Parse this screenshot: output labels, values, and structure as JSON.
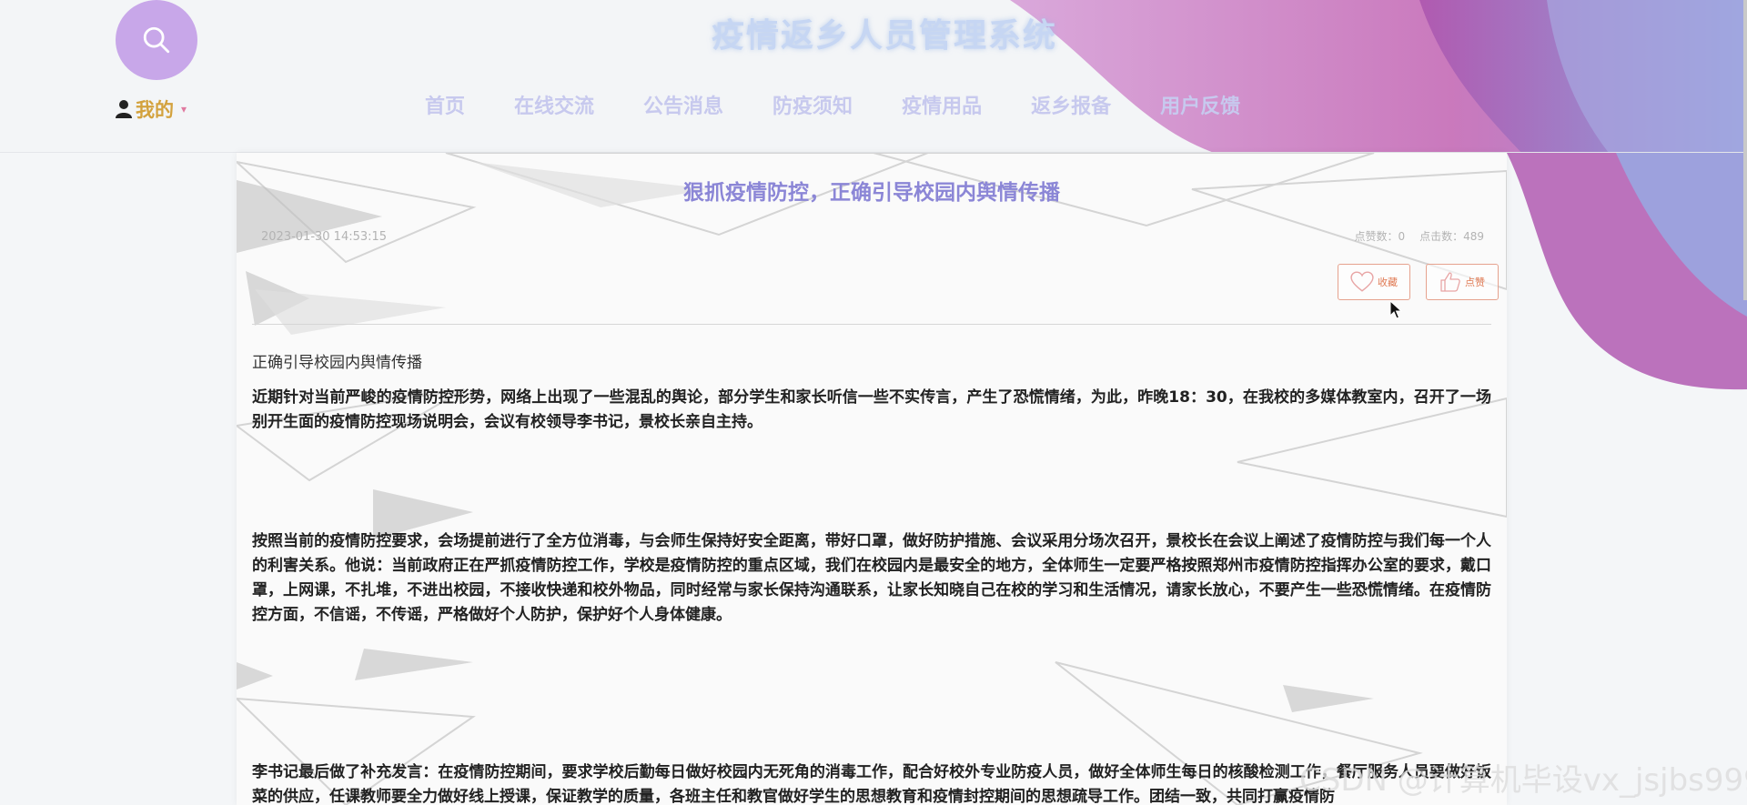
{
  "site": {
    "title": "疫情返乡人员管理系统"
  },
  "user_menu": {
    "label": "我的",
    "caret": "▾"
  },
  "nav": [
    {
      "label": "首页"
    },
    {
      "label": "在线交流"
    },
    {
      "label": "公告消息"
    },
    {
      "label": "防疫须知"
    },
    {
      "label": "疫情用品"
    },
    {
      "label": "返乡报备"
    },
    {
      "label": "用户反馈"
    }
  ],
  "article": {
    "title": "狠抓疫情防控，正确引导校园内舆情传播",
    "date": "2023-01-30 14:53:15",
    "likes_label": "点赞数：0",
    "clicks_label": "点击数：489",
    "collect_label": "收藏",
    "like_label": "点赞",
    "subhead": "正确引导校园内舆情传播",
    "paragraphs": [
      "近期针对当前严峻的疫情防控形势，网络上出现了一些混乱的舆论，部分学生和家长听信一些不实传言，产生了恐慌情绪，为此，昨晚18：30，在我校的多媒体教室内，召开了一场别开生面的疫情防控现场说明会，会议有校领导李书记，景校长亲自主持。",
      "按照当前的疫情防控要求，会场提前进行了全方位消毒，与会师生保持好安全距离，带好口罩，做好防护措施、会议采用分场次召开，景校长在会议上阐述了疫情防控与我们每一个人的利害关系。他说：当前政府正在严抓疫情防控工作，学校是疫情防控的重点区域，我们在校园内是最安全的地方，全体师生一定要严格按照郑州市疫情防控指挥办公室的要求，戴口罩，上网课，不扎堆，不进出校园，不接收快递和校外物品，同时经常与家长保持沟通联系，让家长知晓自己在校的学习和生活情况，请家长放心，不要产生一些恐慌情绪。在疫情防控方面，不信谣，不传谣，严格做好个人防护，保护好个人身体健康。",
      "李书记最后做了补充发言：在疫情防控期间，要求学校后勤每日做好校园内无死角的消毒工作，配合好校外专业防疫人员，做好全体师生每日的核酸检测工作，餐厅服务人员要做好饭菜的供应，任课教师要全力做好线上授课，保证教学的质量，各班主任和教官做好学生的思想教育和疫情封控期间的思想疏导工作。团结一致，共同打赢疫情防"
    ]
  },
  "watermark": "CSDN @计算机毕设vx_jsjbs999",
  "colors": {
    "accent_purple": "#8b86d6",
    "user_gold": "#d3a23e",
    "search_circle": "#c8a7e9",
    "button_orange": "#e07a54"
  },
  "icons": [
    "search-icon",
    "user-icon",
    "heart-icon",
    "thumbs-up-icon"
  ]
}
